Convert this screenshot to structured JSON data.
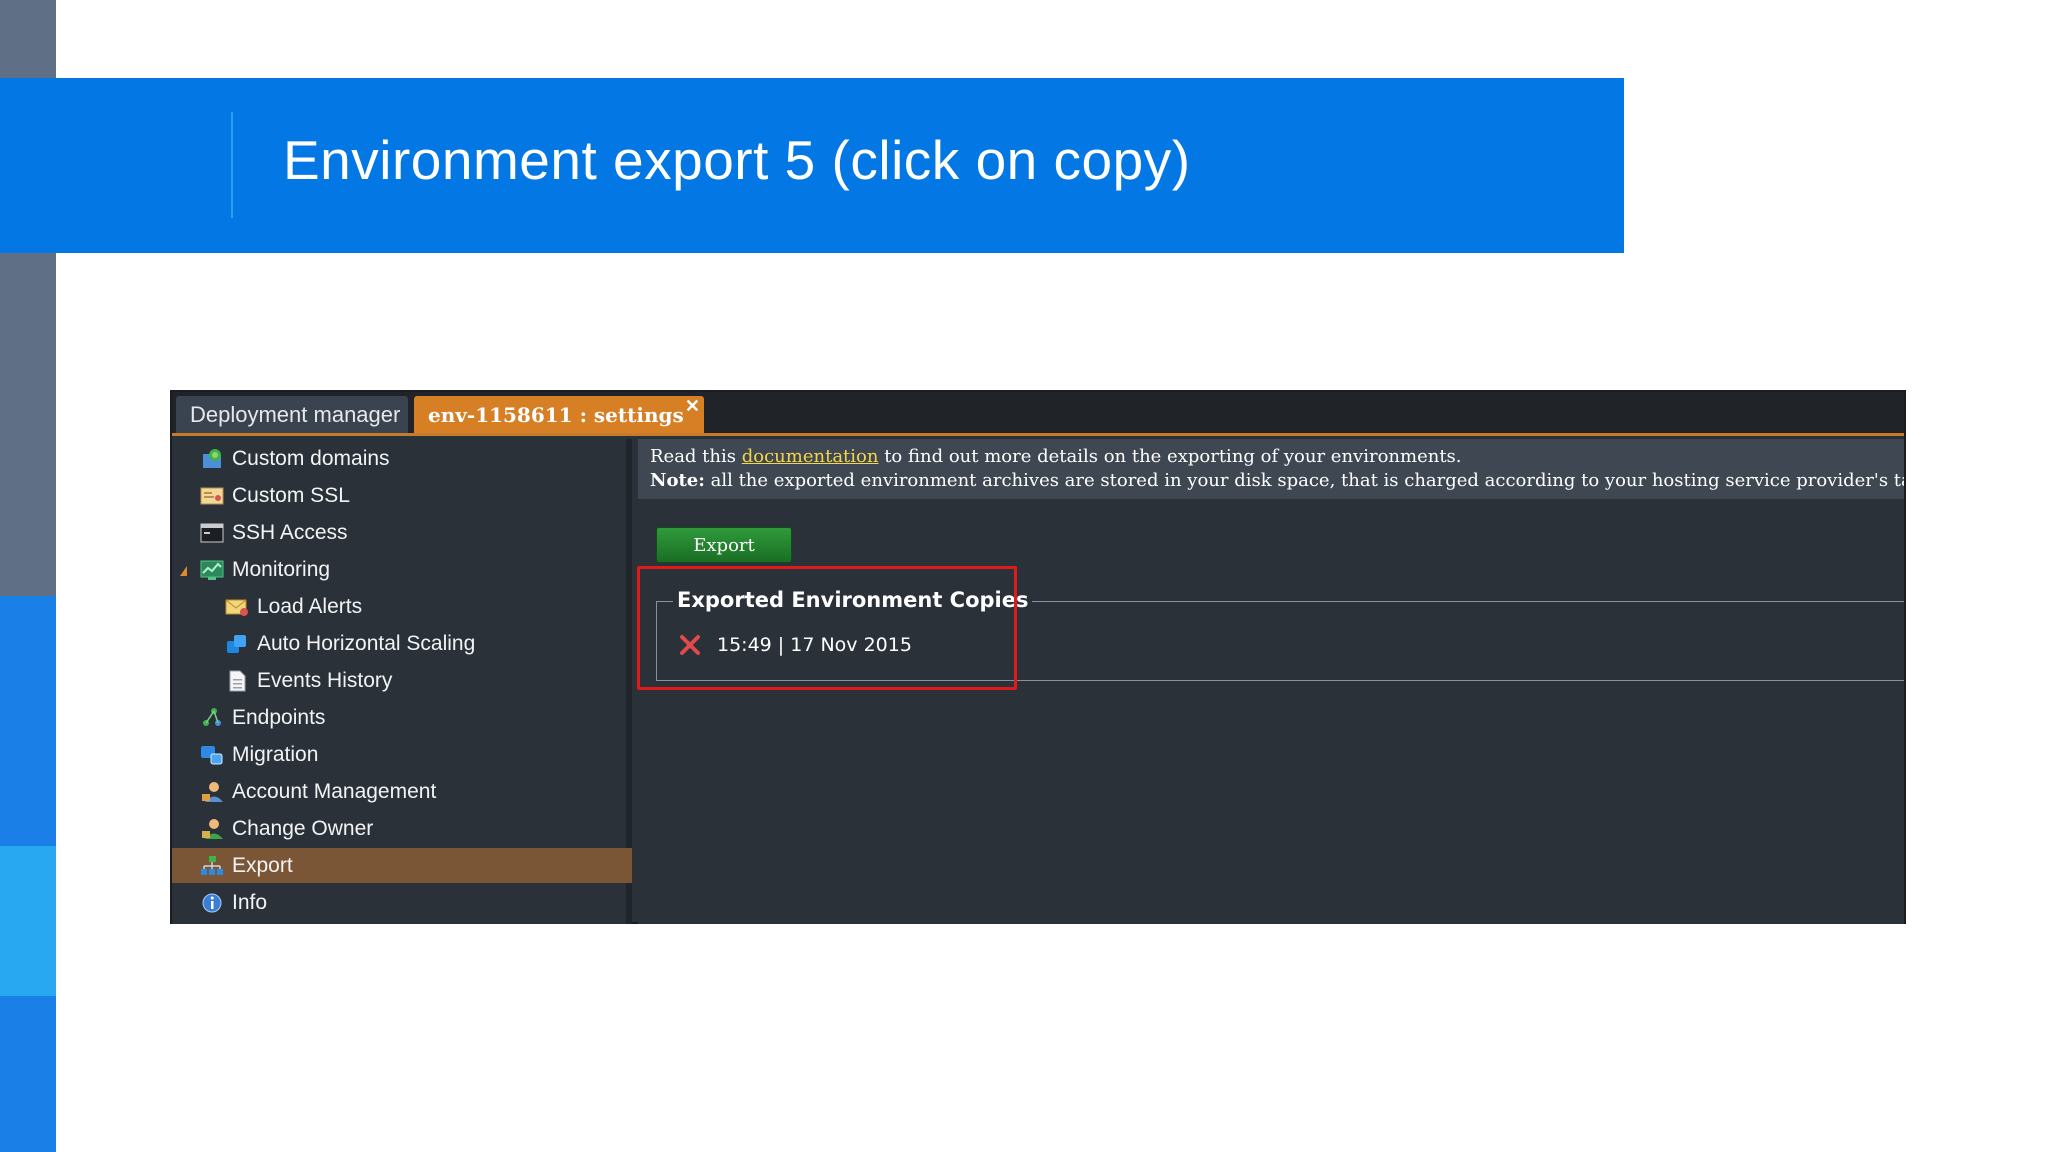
{
  "slide": {
    "title": "Environment export 5 (click on copy)"
  },
  "tabs": {
    "deployment_manager": "Deployment manager",
    "settings": "env-1158611 : settings",
    "close_glyph": "✕"
  },
  "sidebar": {
    "items": [
      {
        "label": "Custom domains",
        "icon": "globe-icon"
      },
      {
        "label": "Custom SSL",
        "icon": "certificate-icon"
      },
      {
        "label": "SSH Access",
        "icon": "terminal-icon"
      },
      {
        "label": "Monitoring",
        "icon": "monitor-icon"
      },
      {
        "label": "Load Alerts",
        "icon": "mail-alert-icon"
      },
      {
        "label": "Auto Horizontal Scaling",
        "icon": "scaling-icon"
      },
      {
        "label": "Events History",
        "icon": "document-icon"
      },
      {
        "label": "Endpoints",
        "icon": "endpoints-icon"
      },
      {
        "label": "Migration",
        "icon": "migration-icon"
      },
      {
        "label": "Account Management",
        "icon": "user-icon"
      },
      {
        "label": "Change Owner",
        "icon": "user-change-icon"
      },
      {
        "label": "Export",
        "icon": "export-icon"
      },
      {
        "label": "Info",
        "icon": "info-icon"
      }
    ],
    "active": "Export"
  },
  "main": {
    "info_prefix": "Read this ",
    "info_link": "documentation",
    "info_suffix": " to find out more details on the exporting of your environments.",
    "note_label": "Note:",
    "note_text": " all the exported environment archives are stored in your disk space, that is charged according to your hosting service provider's tariff.",
    "export_button": "Export",
    "copies_legend": "Exported Environment Copies",
    "copies": [
      {
        "label": "15:49 | 17 Nov 2015"
      }
    ]
  },
  "colors": {
    "banner": "#0377e3",
    "active_tab": "#d67f25",
    "active_item": "#7a5536",
    "highlight": "#e01a1a"
  }
}
